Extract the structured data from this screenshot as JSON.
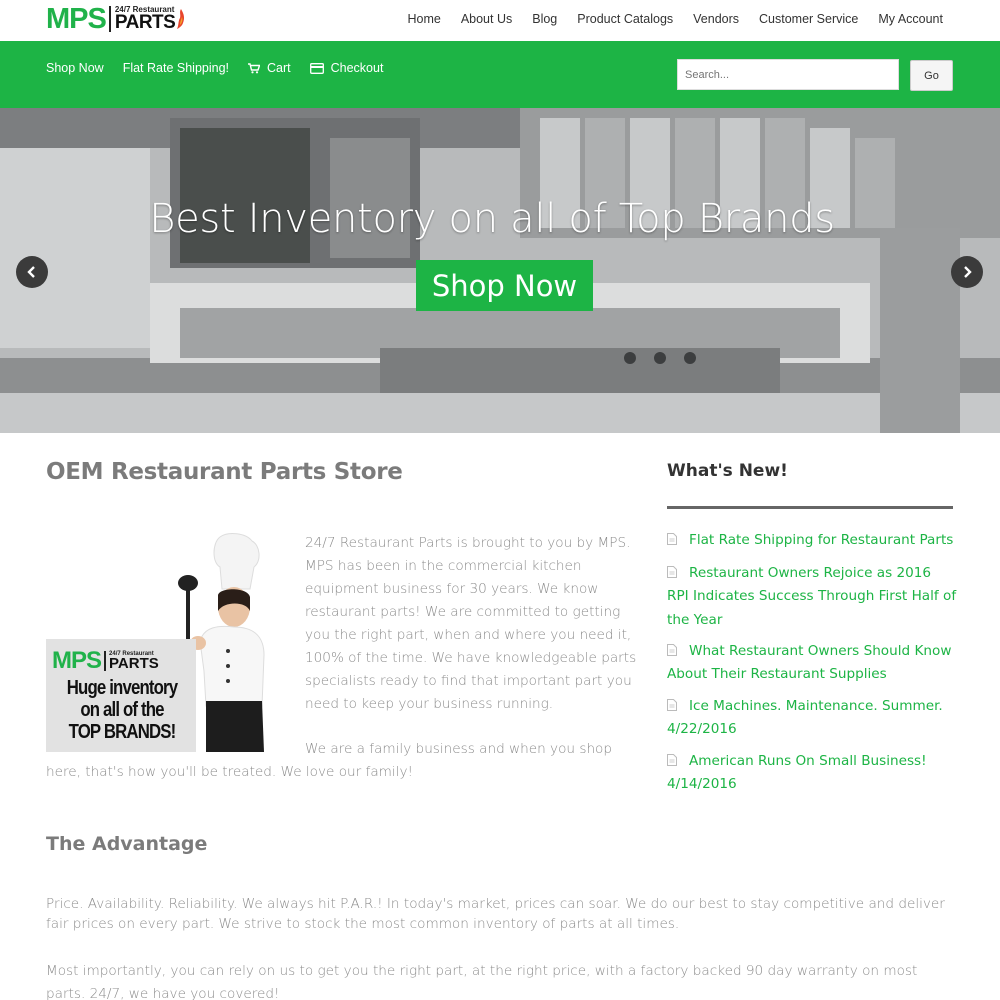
{
  "brand": {
    "logo_mps": "MPS",
    "logo_tagline": "24/7 Restaurant",
    "logo_parts": "PARTS",
    "accent_color": "#1db445"
  },
  "topnav": {
    "items": [
      {
        "label": "Home"
      },
      {
        "label": "About Us"
      },
      {
        "label": "Blog"
      },
      {
        "label": "Product Catalogs"
      },
      {
        "label": "Vendors"
      },
      {
        "label": "Customer Service"
      },
      {
        "label": "My Account"
      }
    ]
  },
  "greenbar": {
    "items": [
      {
        "label": "Shop Now",
        "icon": ""
      },
      {
        "label": "Flat Rate Shipping!",
        "icon": ""
      },
      {
        "label": "Cart",
        "icon": "cart-icon"
      },
      {
        "label": "Checkout",
        "icon": "credit-card-icon"
      }
    ],
    "search_placeholder": "Search...",
    "search_value": "",
    "go_label": "Go"
  },
  "hero": {
    "title": "Best Inventory on all of Top Brands",
    "button_label": "Shop Now",
    "prev_icon": "chevron-left-icon",
    "next_icon": "chevron-right-icon"
  },
  "main": {
    "heading": "OEM Restaurant Parts Store",
    "promo": {
      "logo_mps": "MPS",
      "logo_tagline": "24/7 Restaurant",
      "logo_parts": "PARTS",
      "line1": "Huge inventory",
      "line2": "on all of the",
      "line3": "TOP BRANDS!"
    },
    "paragraph1": "24/7 Restaurant Parts is brought to you by MPS. MPS has been in the commercial kitchen equipment business for 30 years. We know restaurant parts! We are committed to getting you the right part, when and where you need it, 100% of the time. We have knowledgeable parts specialists ready to find that important part you need to keep your business running.",
    "paragraph2": "We are a family business and when you shop here, that's how you'll be treated. We love our family!",
    "advantage_heading": "The Advantage",
    "paragraph3": "Price. Availability. Reliability. We always hit P.A.R.! In today's market, prices can soar. We do our best to stay competitive and deliver fair prices on every part. We strive to stock the most common inventory of parts at all times.",
    "paragraph4": "Most importantly, you can rely on us to get you the right part, at the right price, with a factory backed 90 day warranty on most parts. 24/7, we have you covered!"
  },
  "sidebar": {
    "heading": "What's New!",
    "posts": [
      {
        "title": "Flat Rate Shipping for Restaurant Parts"
      },
      {
        "title": "Restaurant Owners Rejoice as 2016 RPI Indicates Success Through First Half of the Year"
      },
      {
        "title": "What Restaurant Owners Should Know About Their Restaurant Supplies"
      },
      {
        "title": "Ice Machines. Maintenance. Summer. 4/22/2016"
      },
      {
        "title": "American Runs On Small Business! 4/14/2016"
      }
    ]
  }
}
